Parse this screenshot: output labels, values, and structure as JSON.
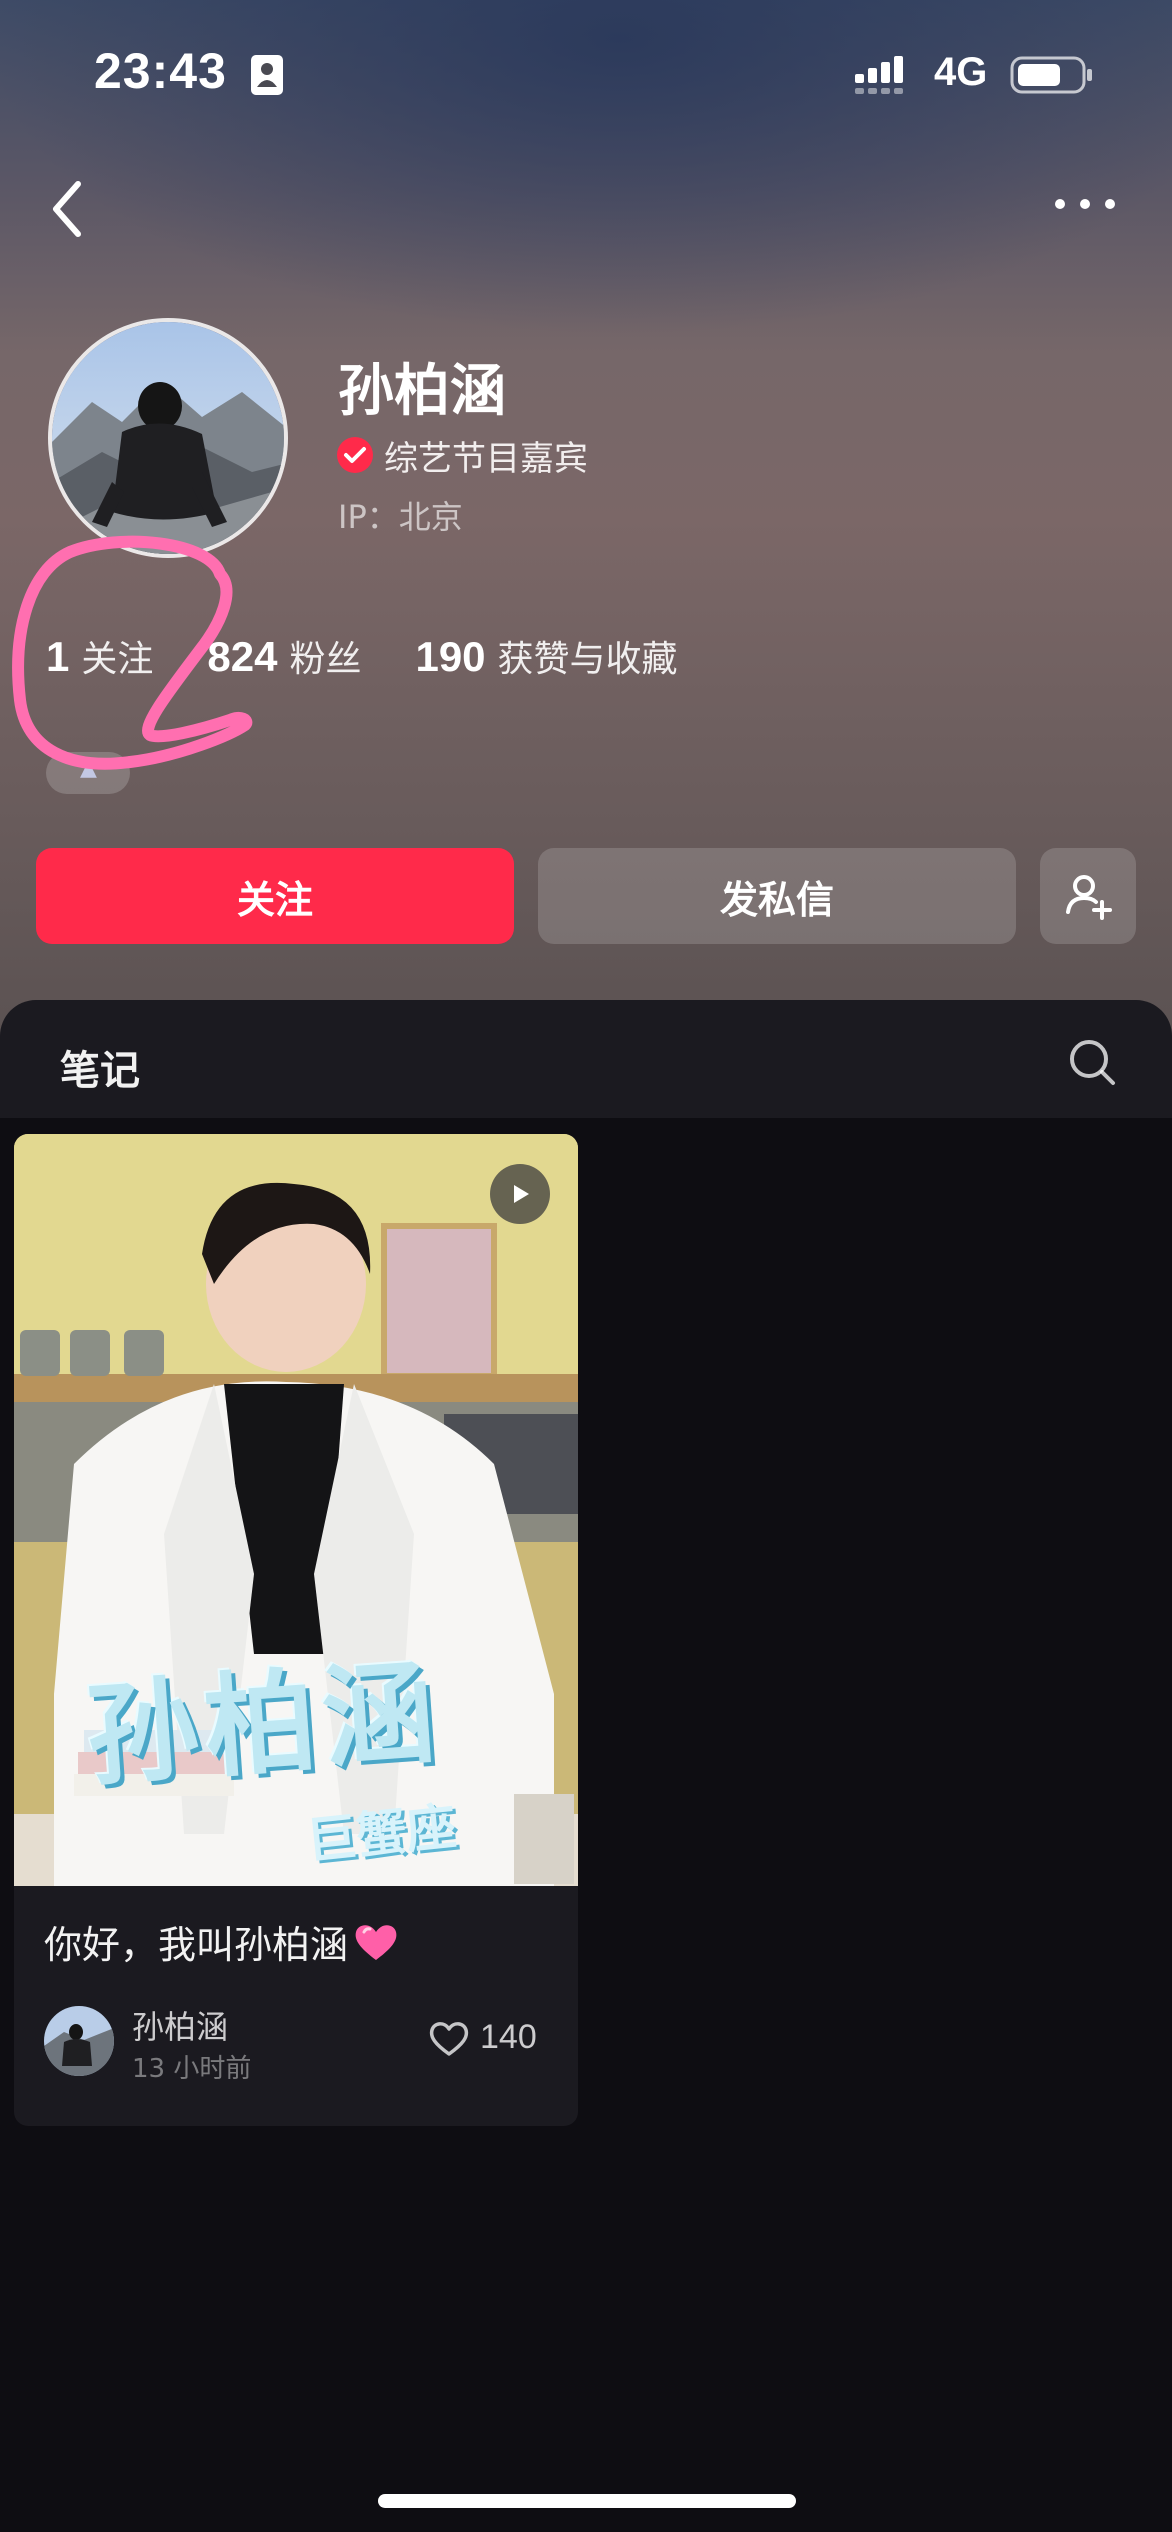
{
  "status_bar": {
    "time": "23:43",
    "network": "4G",
    "battery_level": 0.7
  },
  "nav": {
    "back_icon": "chevron-left-icon",
    "more_icon": "more-horizontal-icon"
  },
  "profile": {
    "name": "孙柏涵",
    "verified_label": "综艺节目嘉宾",
    "ip_label": "IP：",
    "ip_value": "北京",
    "avatar_icon": "profile-avatar"
  },
  "stats": [
    {
      "value": "1",
      "label": "关注"
    },
    {
      "value": "824",
      "label": "粉丝"
    },
    {
      "value": "190",
      "label": "获赞与收藏"
    }
  ],
  "actions": {
    "follow_label": "关注",
    "message_label": "发私信",
    "add_friend_icon": "add-user-icon"
  },
  "tabs": {
    "notes_label": "笔记",
    "search_icon": "search-icon"
  },
  "note": {
    "cover_title": "孙柏涵",
    "cover_subtitle": "巨蟹座",
    "title": "你好，我叫孙柏涵",
    "author": "孙柏涵",
    "time": "13 小时前",
    "likes": "140"
  },
  "colors": {
    "accent": "#ff2a4a",
    "annotation": "#ff6fb0"
  }
}
